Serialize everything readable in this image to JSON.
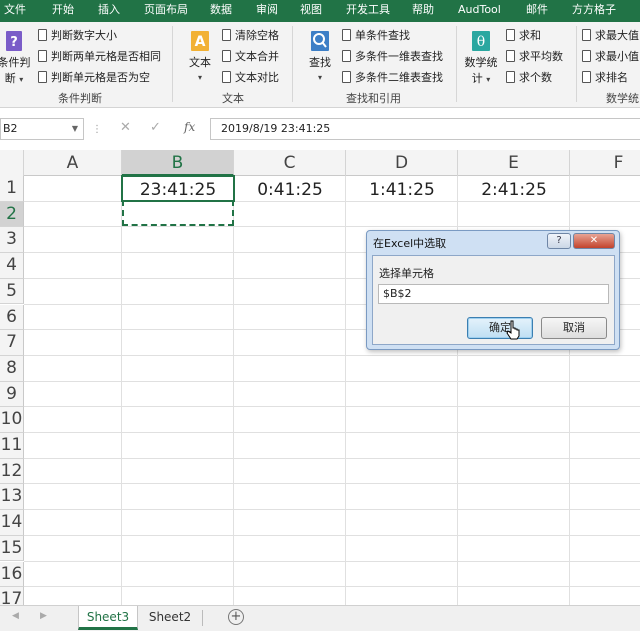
{
  "menu": [
    "文件",
    "开始",
    "插入",
    "页面布局",
    "数据",
    "审阅",
    "视图",
    "开发工具",
    "帮助",
    "AudTool",
    "邮件",
    "方方格子"
  ],
  "ribbon": {
    "cond": {
      "big_label_1": "条件判",
      "big_label_2": "断",
      "items": [
        "判断数字大小",
        "判断两单元格是否相同",
        "判断单元格是否为空"
      ],
      "group_label": "条件判断"
    },
    "text": {
      "big_label": "文本",
      "items": [
        "清除空格",
        "文本合并",
        "文本对比"
      ],
      "group_label": "文本"
    },
    "find": {
      "big_label": "查找",
      "items": [
        "单条件查找",
        "多条件一维表查找",
        "多条件二维表查找"
      ],
      "group_label": "查找和引用"
    },
    "math": {
      "big_label_1": "数学统",
      "big_label_2": "计",
      "items": [
        "求和",
        "求平均数",
        "求个数"
      ],
      "items2": [
        "求最大值",
        "求最小值",
        "求排名"
      ],
      "group_label": "数学统"
    }
  },
  "formula_bar": {
    "name_box": "B2",
    "fx": "fx",
    "formula": "2019/8/19  23:41:25"
  },
  "columns": [
    "A",
    "B",
    "C",
    "D",
    "E",
    "F"
  ],
  "rows": [
    "1",
    "2",
    "3",
    "4",
    "5",
    "6",
    "7",
    "8",
    "9",
    "10",
    "11",
    "12",
    "13",
    "14",
    "15",
    "16",
    "17"
  ],
  "cells": {
    "B1": "23:41:25",
    "C1": "0:41:25",
    "D1": "1:41:25",
    "E1": "2:41:25"
  },
  "sheets": [
    "Sheet3",
    "Sheet2"
  ],
  "active_sheet": "Sheet3",
  "dialog": {
    "title": "在Excel中选取",
    "help": "?",
    "label": "选择单元格",
    "value": "$B$2",
    "ok": "确定",
    "cancel": "取消"
  },
  "colors": {
    "excel_green": "#217346",
    "dialog_frame": "#cfe0f3"
  }
}
